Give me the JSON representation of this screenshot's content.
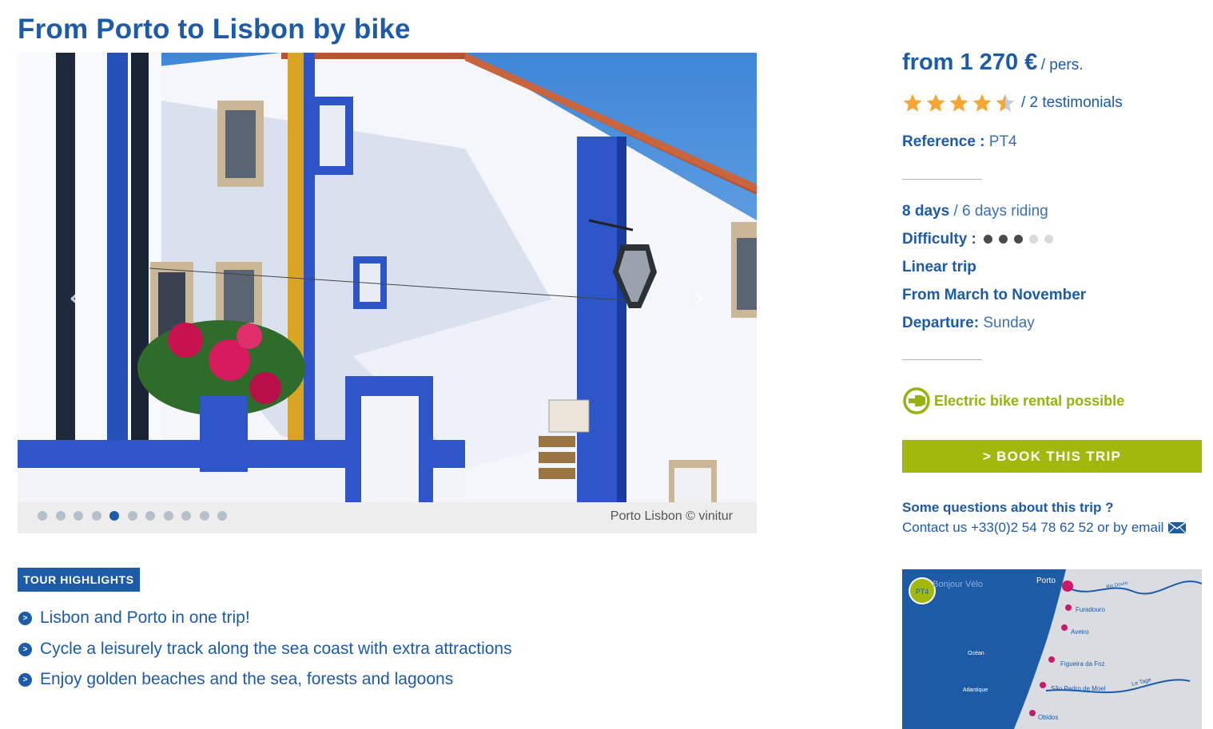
{
  "title": "From Porto to Lisbon by bike",
  "slider": {
    "caption": "Porto Lisbon © vinitur",
    "dot_count": 11,
    "active_index": 4,
    "prev_glyph": "‹",
    "next_glyph": "›"
  },
  "highlights": {
    "badge": "TOUR HIGHLIGHTS",
    "items": [
      "Lisbon and Porto in one trip!",
      "Cycle a leisurely track along the sea coast with extra attractions",
      "Enjoy golden beaches and the sea, forests and lagoons"
    ],
    "bullet_glyph": ">"
  },
  "pricing": {
    "amount": "from 1 270 €",
    "per": "/ pers."
  },
  "rating": {
    "stars": 4.5,
    "max": 5,
    "testimonials": "/ 2 testimonials"
  },
  "reference": {
    "label": "Reference :",
    "value": "PT4"
  },
  "trip": {
    "days_label": "8 days",
    "days_value": "/ 6 days riding",
    "difficulty_label": "Difficulty :",
    "difficulty_level": 3,
    "difficulty_max": 5,
    "type": "Linear trip",
    "season": "From March to November",
    "departure_label": "Departure:",
    "departure_value": "Sunday"
  },
  "ebike": {
    "text": "Electric bike rental possible"
  },
  "book_button": "> BOOK THIS TRIP",
  "contact": {
    "question": "Some questions about this trip ?",
    "line": "Contact us +33(0)2 54 78 62 52 or by email"
  },
  "map": {
    "badge": "PT4",
    "brand": "Bonjour Vélo",
    "places": [
      "Porto",
      "Furadouro",
      "Aveiro",
      "Figueira da Foz",
      "São Pedro de Moel",
      "Obidos"
    ],
    "sea_labels": [
      "Océan",
      "Atlantique"
    ],
    "rivers": [
      "Rio Douro",
      "Le Tage"
    ]
  },
  "colors": {
    "brand_blue": "#1d5ba6",
    "accent_green": "#a1b90c",
    "star": "#f7a631"
  },
  "icons": [
    "chevron-left-icon",
    "chevron-right-icon",
    "bullet-arrow-icon",
    "star-icon",
    "electric-plug-icon",
    "envelope-icon"
  ]
}
